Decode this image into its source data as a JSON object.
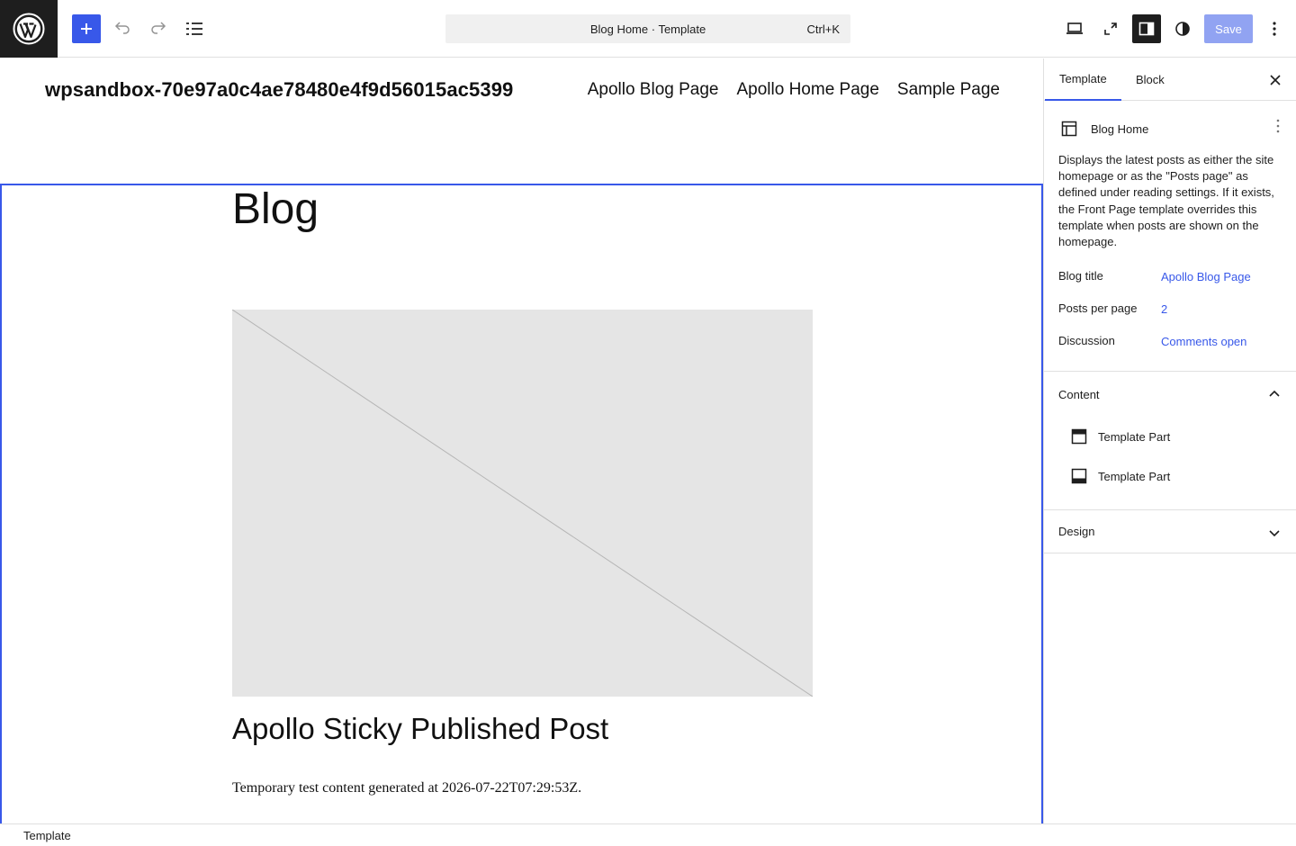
{
  "toolbar": {
    "logo_icon": "wordpress-logo-icon",
    "add_block_icon": "plus-icon",
    "undo_icon": "undo-icon",
    "redo_icon": "redo-icon",
    "document_overview_icon": "list-view-icon",
    "command_bar_label": "Blog Home · Template",
    "command_bar_shortcut": "Ctrl+K",
    "view_icon": "desktop-icon",
    "fullscreen_icon": "fullscreen-icon",
    "settings_icon": "sidebar-toggle-icon",
    "styles_icon": "contrast-icon",
    "save_label": "Save",
    "options_icon": "more-vertical-icon",
    "accent_color": "#3858e9"
  },
  "canvas": {
    "site_title": "wpsandbox-70e97a0c4ae78480e4f9d56015ac5399",
    "nav_items": [
      "Apollo Blog Page",
      "Apollo Home Page",
      "Sample Page"
    ],
    "blog_heading": "Blog",
    "post_title": "Apollo Sticky Published Post",
    "post_excerpt": "Temporary test content generated at 2026-07-22T07:29:53Z."
  },
  "sidebar": {
    "tabs": [
      {
        "label": "Template",
        "active": true
      },
      {
        "label": "Block",
        "active": false
      }
    ],
    "close_icon": "close-icon",
    "template_icon": "layout-icon",
    "template_name": "Blog Home",
    "template_description": "Displays the latest posts as either the site homepage or as the \"Posts page\" as defined under reading settings. If it exists, the Front Page template overrides this template when posts are shown on the homepage.",
    "fields": [
      {
        "label": "Blog title",
        "value": "Apollo Blog Page"
      },
      {
        "label": "Posts per page",
        "value": "2"
      },
      {
        "label": "Discussion",
        "value": "Comments open"
      }
    ],
    "content_panel": {
      "title": "Content",
      "expanded": true,
      "items": [
        {
          "icon": "header-template-part-icon",
          "label": "Template Part"
        },
        {
          "icon": "footer-template-part-icon",
          "label": "Template Part"
        }
      ]
    },
    "design_panel": {
      "title": "Design",
      "expanded": false
    }
  },
  "footer": {
    "breadcrumb": "Template"
  }
}
